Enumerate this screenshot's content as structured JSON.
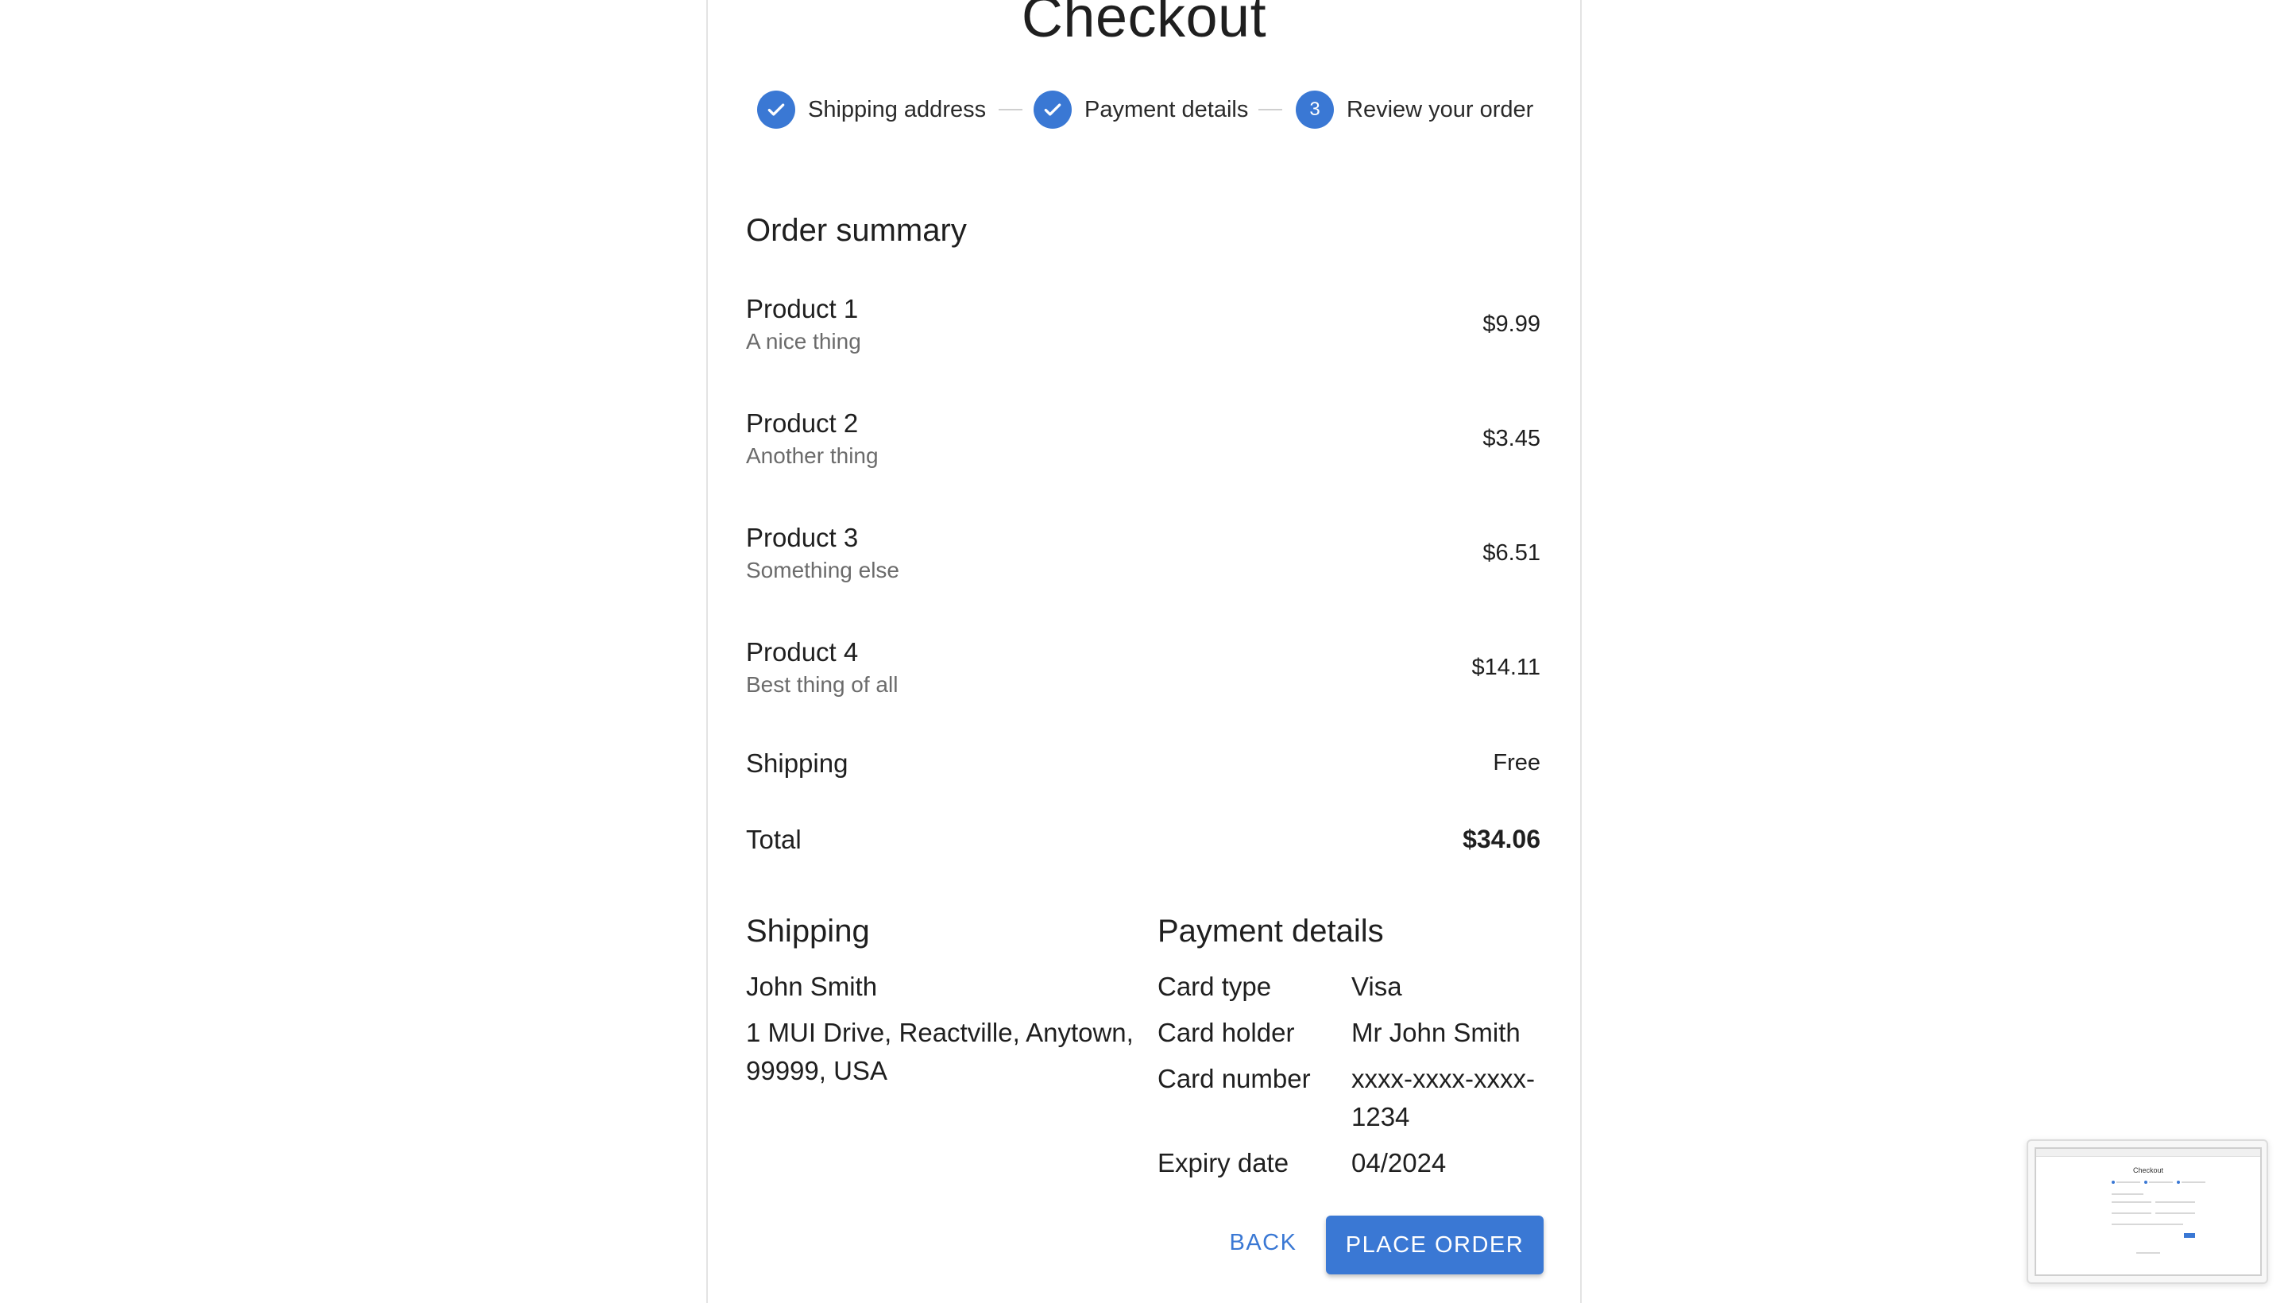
{
  "page": {
    "title": "Checkout"
  },
  "stepper": {
    "steps": [
      {
        "label": "Shipping address",
        "state": "completed"
      },
      {
        "label": "Payment details",
        "state": "completed"
      },
      {
        "label": "Review your order",
        "state": "active",
        "number": "3"
      }
    ]
  },
  "order_summary": {
    "title": "Order summary",
    "products": [
      {
        "name": "Product 1",
        "desc": "A nice thing",
        "price": "$9.99"
      },
      {
        "name": "Product 2",
        "desc": "Another thing",
        "price": "$3.45"
      },
      {
        "name": "Product 3",
        "desc": "Something else",
        "price": "$6.51"
      },
      {
        "name": "Product 4",
        "desc": "Best thing of all",
        "price": "$14.11"
      }
    ],
    "shipping_label": "Shipping",
    "shipping_value": "Free",
    "total_label": "Total",
    "total_value": "$34.06"
  },
  "shipping": {
    "title": "Shipping",
    "name": "John Smith",
    "address_line1": "1 MUI Drive, Reactville, Anytown,",
    "address_line2": "99999, USA"
  },
  "payment": {
    "title": "Payment details",
    "rows": [
      {
        "label": "Card type",
        "value": "Visa"
      },
      {
        "label": "Card holder",
        "value": "Mr John Smith"
      },
      {
        "label": "Card number",
        "value": "xxxx-xxxx-xxxx-",
        "value2": "1234"
      },
      {
        "label": "Expiry date",
        "value": "04/2024"
      }
    ]
  },
  "actions": {
    "back_label": "BACK",
    "place_order_label": "PLACE ORDER"
  },
  "thumbnail": {
    "title": "Checkout"
  },
  "colors": {
    "accent": "#3a78d4",
    "text": "#1f1f1f",
    "secondary_text": "#6b6b6b"
  }
}
